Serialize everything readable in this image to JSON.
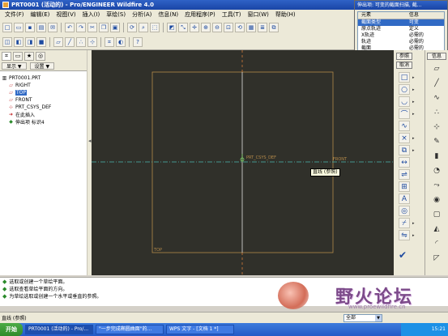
{
  "window": {
    "title": "PRT0001 (活动的) - Pro/ENGINEER Wildfire 4.0"
  },
  "menubar": [
    "文件(F)",
    "编辑(E)",
    "视图(V)",
    "插入(I)",
    "草绘(S)",
    "分析(A)",
    "信息(N)",
    "应用程序(P)",
    "工具(T)",
    "窗口(W)",
    "帮助(H)"
  ],
  "menu_manager": {
    "title": "伸出项: 可变的截面扫描, 截...",
    "col_element": "元素",
    "col_info": "信息",
    "rows": [
      {
        "element": "截面类型",
        "info": "可变"
      },
      {
        "element": "原点轨迹",
        "info": "定义"
      },
      {
        "element": "X轨迹",
        "info": "必需的"
      },
      {
        "element": "轨迹",
        "info": "必需的"
      },
      {
        "element": "截面",
        "info": "必需的"
      }
    ],
    "reference_button": "参照",
    "cancel_button": "取消",
    "info_button": "信息"
  },
  "tree": {
    "show_label": "显示 ▼",
    "settings_label": "设置 ▼",
    "nodes": [
      "PRT0001.PRT",
      "RIGHT",
      "TOP",
      "FRONT",
      "PRT_CSYS_DEF",
      "在此插入",
      "伸出项 标识4"
    ]
  },
  "canvas": {
    "csys_label": "PRT_CSYS_DEF",
    "right_label": "FRONT",
    "top_label": "TOP",
    "tooltip": "直线 (参照)"
  },
  "messages": [
    "选取或创建一个草绘平面。",
    "选取查看草绘平面的方向。",
    "为草绘选取或创建一个水平或垂直的参照。"
  ],
  "watermark": {
    "text": "野火论坛",
    "url": "www.proewildfire.cn"
  },
  "status": {
    "text": "直线 (参照)",
    "filter": "全部"
  },
  "taskbar": {
    "start": "开始",
    "tasks": [
      "PRT0001 (活动的) - Pro/...",
      "\"一步完成椭圆曲面\"的...",
      "WPS 文字 - [文档 1 *]"
    ],
    "clock": "15:21"
  },
  "icons": {
    "sketch_tools": [
      "select-arrow-icon",
      "line-icon",
      "rectangle-icon",
      "circle-icon",
      "arc-icon",
      "fillet-icon",
      "spline-icon",
      "point-icon",
      "offset-edge-icon",
      "dimension-icon",
      "modify-icon",
      "constraints-icon",
      "text-icon",
      "palette-icon",
      "trim-icon",
      "mirror-icon"
    ]
  }
}
